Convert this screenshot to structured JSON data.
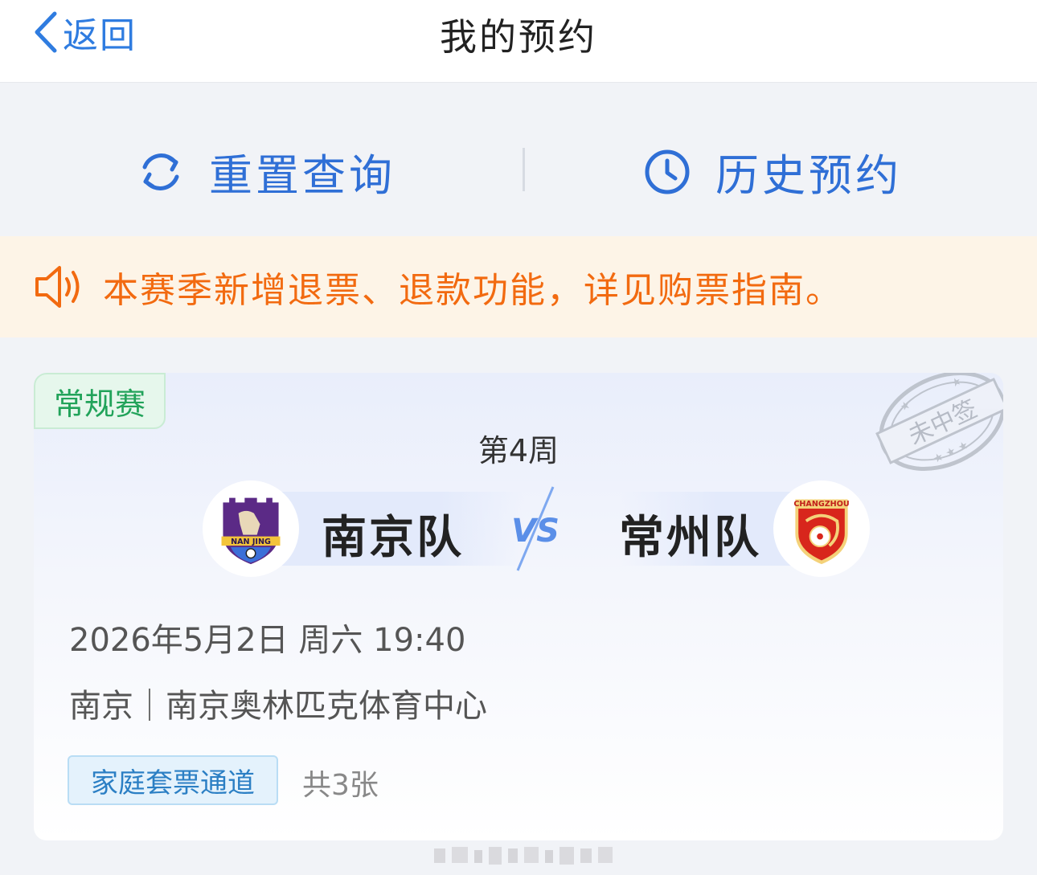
{
  "header": {
    "back_label": "返回",
    "title": "我的预约"
  },
  "actions": {
    "reset_label": "重置查询",
    "history_label": "历史预约"
  },
  "notice": {
    "text": "本赛季新增退票、退款功能，详见购票指南。"
  },
  "card": {
    "type_tag": "常规赛",
    "week": "第4周",
    "home_team": "南京队",
    "away_team": "常州队",
    "home_logo_text": "NAN JING",
    "away_logo_text": "CHANGZHOU",
    "vs_text": "VS",
    "stamp_text": "未中签",
    "datetime": "2026年5月2日 周六 19:40",
    "venue": "南京｜南京奥林匹克体育中心",
    "channel_tag": "家庭套票通道",
    "ticket_count": "共3张"
  },
  "colors": {
    "accent_blue": "#2f6fd6",
    "notice_orange": "#f26a10",
    "notice_bg": "#fdf4e7",
    "regular_green": "#22a35a"
  },
  "icons": {
    "back": "chevron-left-icon",
    "reset": "refresh-icon",
    "history": "clock-icon",
    "notice": "speaker-icon"
  }
}
